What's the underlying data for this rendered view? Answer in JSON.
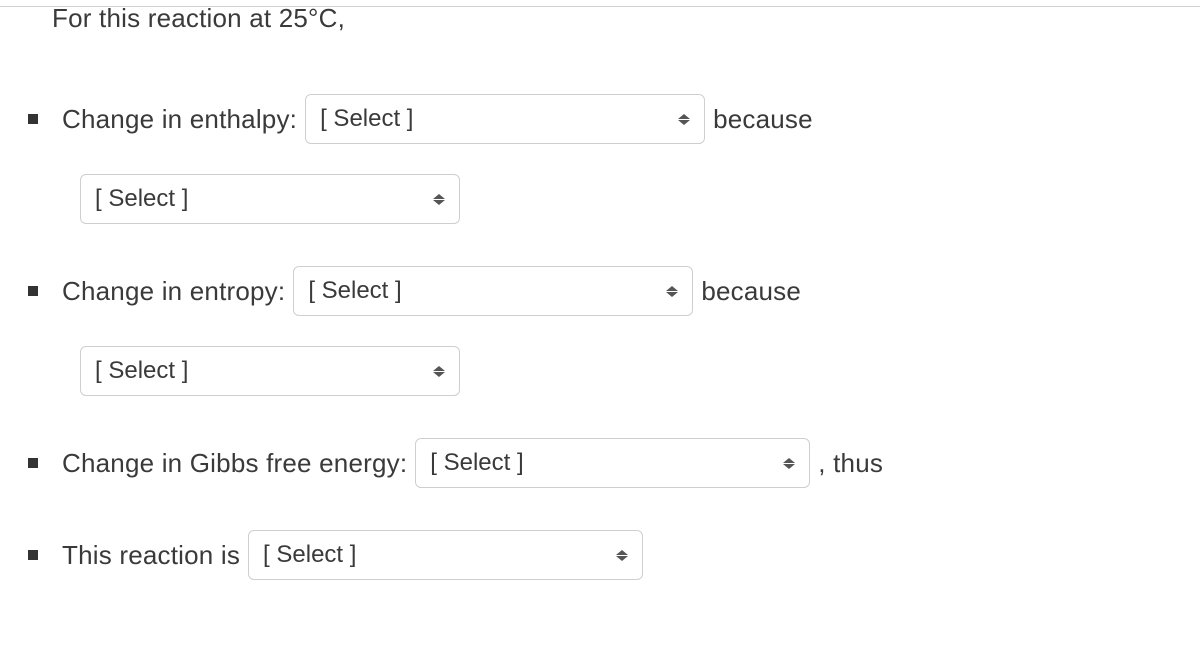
{
  "intro": "For this reaction at 25°C,",
  "items": {
    "enthalpy": {
      "label": "Change in enthalpy: ",
      "select1": "[ Select ]",
      "after1": "because",
      "select2": "[ Select ]"
    },
    "entropy": {
      "label": "Change in entropy: ",
      "select1": "[ Select ]",
      "after1": "because",
      "select2": "[ Select ]"
    },
    "gibbs": {
      "label": "Change in Gibbs free energy: ",
      "select1": "[ Select ]",
      "after1": ", thus"
    },
    "reaction": {
      "label": "This reaction is ",
      "select1": "[ Select ]"
    }
  }
}
